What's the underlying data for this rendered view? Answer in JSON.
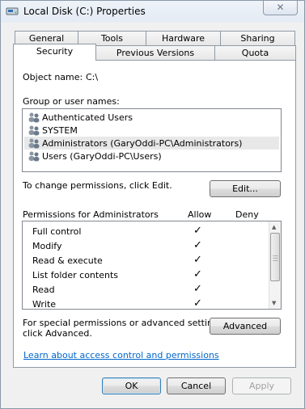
{
  "window": {
    "title": "Local Disk  (C:) Properties",
    "close_glyph": "✕"
  },
  "tabs": {
    "row1": [
      "General",
      "Tools",
      "Hardware",
      "Sharing"
    ],
    "row2": [
      "Security",
      "Previous Versions",
      "Quota"
    ],
    "active": "Security"
  },
  "security": {
    "object_name_label": "Object name:",
    "object_name_value": "C:\\",
    "group_label": "Group or user names:",
    "users": [
      {
        "name": "Authenticated Users",
        "icon": "users-group-icon"
      },
      {
        "name": "SYSTEM",
        "icon": "users-group-icon"
      },
      {
        "name": "Administrators (GaryOddi-PC\\Administrators)",
        "icon": "users-group-icon",
        "selected": true
      },
      {
        "name": "Users (GaryOddi-PC\\Users)",
        "icon": "users-group-icon"
      }
    ],
    "change_text": "To change permissions, click Edit.",
    "edit_button": "Edit...",
    "permissions_header": "Permissions for Administrators",
    "allow_header": "Allow",
    "deny_header": "Deny",
    "permissions": [
      {
        "name": "Full control",
        "allow": "✓",
        "deny": ""
      },
      {
        "name": "Modify",
        "allow": "✓",
        "deny": ""
      },
      {
        "name": "Read & execute",
        "allow": "✓",
        "deny": ""
      },
      {
        "name": "List folder contents",
        "allow": "✓",
        "deny": ""
      },
      {
        "name": "Read",
        "allow": "✓",
        "deny": ""
      },
      {
        "name": "Write",
        "allow": "✓",
        "deny": ""
      }
    ],
    "special_text_line1": "For special permissions or advanced settings,",
    "special_text_line2": "click Advanced.",
    "advanced_button": "Advanced",
    "learn_link": "Learn about access control and permissions"
  },
  "footer": {
    "ok": "OK",
    "cancel": "Cancel",
    "apply": "Apply"
  },
  "colors": {
    "link": "#0066cc",
    "selected_row": "#e8e8e8",
    "default_button_border": "#3c7fb1"
  }
}
